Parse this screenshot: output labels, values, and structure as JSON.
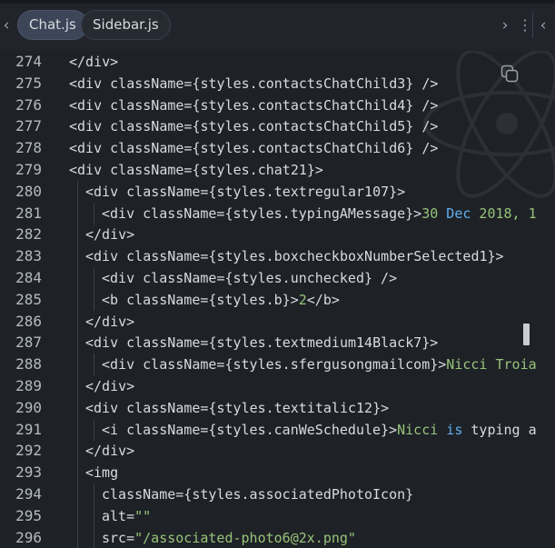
{
  "tabs": [
    {
      "label": "Chat.js",
      "active": true
    },
    {
      "label": "Sidebar.js",
      "active": false
    }
  ],
  "icons": {
    "left": "chevron-left-icon",
    "right": "chevron-right-icon",
    "more": "kebab-menu-icon",
    "collapse": "chevron-left-icon",
    "copy": "copy-icon",
    "watermark": "react-atom-logo"
  },
  "colors": {
    "background": "#1e2227",
    "tab_active": "#3c4658",
    "string": "#98c379",
    "keyword": "#61afef"
  },
  "code": {
    "lines": [
      {
        "num": "274",
        "indent": 0,
        "parts": [
          {
            "t": "</div>",
            "c": ""
          }
        ]
      },
      {
        "num": "275",
        "indent": 0,
        "parts": [
          {
            "t": "<div className={styles.contactsChatChild3} />",
            "c": ""
          }
        ]
      },
      {
        "num": "276",
        "indent": 0,
        "parts": [
          {
            "t": "<div className={styles.contactsChatChild4} />",
            "c": ""
          }
        ]
      },
      {
        "num": "277",
        "indent": 0,
        "parts": [
          {
            "t": "<div className={styles.contactsChatChild5} />",
            "c": ""
          }
        ]
      },
      {
        "num": "278",
        "indent": 0,
        "parts": [
          {
            "t": "<div className={styles.contactsChatChild6} />",
            "c": ""
          }
        ]
      },
      {
        "num": "279",
        "indent": 0,
        "parts": [
          {
            "t": "<div className={styles.chat21}>",
            "c": ""
          }
        ]
      },
      {
        "num": "280",
        "indent": 1,
        "parts": [
          {
            "t": "<div className={styles.textregular107}>",
            "c": ""
          }
        ]
      },
      {
        "num": "281",
        "indent": 2,
        "parts": [
          {
            "t": "<div className={styles.typingAMessage}>",
            "c": ""
          },
          {
            "t": "30 ",
            "c": "str"
          },
          {
            "t": "Dec",
            "c": "kw"
          },
          {
            "t": " 2018, 1",
            "c": "str"
          }
        ]
      },
      {
        "num": "282",
        "indent": 1,
        "parts": [
          {
            "t": "</div>",
            "c": ""
          }
        ]
      },
      {
        "num": "283",
        "indent": 1,
        "parts": [
          {
            "t": "<div className={styles.boxcheckboxNumberSelected1}>",
            "c": ""
          }
        ]
      },
      {
        "num": "284",
        "indent": 2,
        "parts": [
          {
            "t": "<div className={styles.unchecked} />",
            "c": ""
          }
        ]
      },
      {
        "num": "285",
        "indent": 2,
        "parts": [
          {
            "t": "<b className={styles.b}>",
            "c": ""
          },
          {
            "t": "2",
            "c": "str"
          },
          {
            "t": "</b>",
            "c": ""
          }
        ]
      },
      {
        "num": "286",
        "indent": 1,
        "parts": [
          {
            "t": "</div>",
            "c": ""
          }
        ]
      },
      {
        "num": "287",
        "indent": 1,
        "parts": [
          {
            "t": "<div className={styles.textmedium14Black7}>",
            "c": ""
          }
        ]
      },
      {
        "num": "288",
        "indent": 2,
        "parts": [
          {
            "t": "<div className={styles.sfergusongmailcom}>",
            "c": ""
          },
          {
            "t": "Nicci Troia",
            "c": "str"
          }
        ]
      },
      {
        "num": "289",
        "indent": 1,
        "parts": [
          {
            "t": "</div>",
            "c": ""
          }
        ]
      },
      {
        "num": "290",
        "indent": 1,
        "parts": [
          {
            "t": "<div className={styles.textitalic12}>",
            "c": ""
          }
        ]
      },
      {
        "num": "291",
        "indent": 2,
        "parts": [
          {
            "t": "<i className={styles.canWeSchedule}>",
            "c": ""
          },
          {
            "t": "Nicci ",
            "c": "str"
          },
          {
            "t": "is",
            "c": "kw"
          },
          {
            "t": " typing a",
            "c": "pre"
          }
        ]
      },
      {
        "num": "292",
        "indent": 1,
        "parts": [
          {
            "t": "</div>",
            "c": ""
          }
        ]
      },
      {
        "num": "293",
        "indent": 1,
        "parts": [
          {
            "t": "<img",
            "c": ""
          }
        ]
      },
      {
        "num": "294",
        "indent": 2,
        "parts": [
          {
            "t": "className={styles.associatedPhotoIcon}",
            "c": ""
          }
        ]
      },
      {
        "num": "295",
        "indent": 2,
        "parts": [
          {
            "t": "alt=",
            "c": ""
          },
          {
            "t": "\"\"",
            "c": "str"
          }
        ]
      },
      {
        "num": "296",
        "indent": 2,
        "parts": [
          {
            "t": "src=",
            "c": ""
          },
          {
            "t": "\"/associated-photo6@2x.png\"",
            "c": "str"
          }
        ]
      }
    ]
  }
}
